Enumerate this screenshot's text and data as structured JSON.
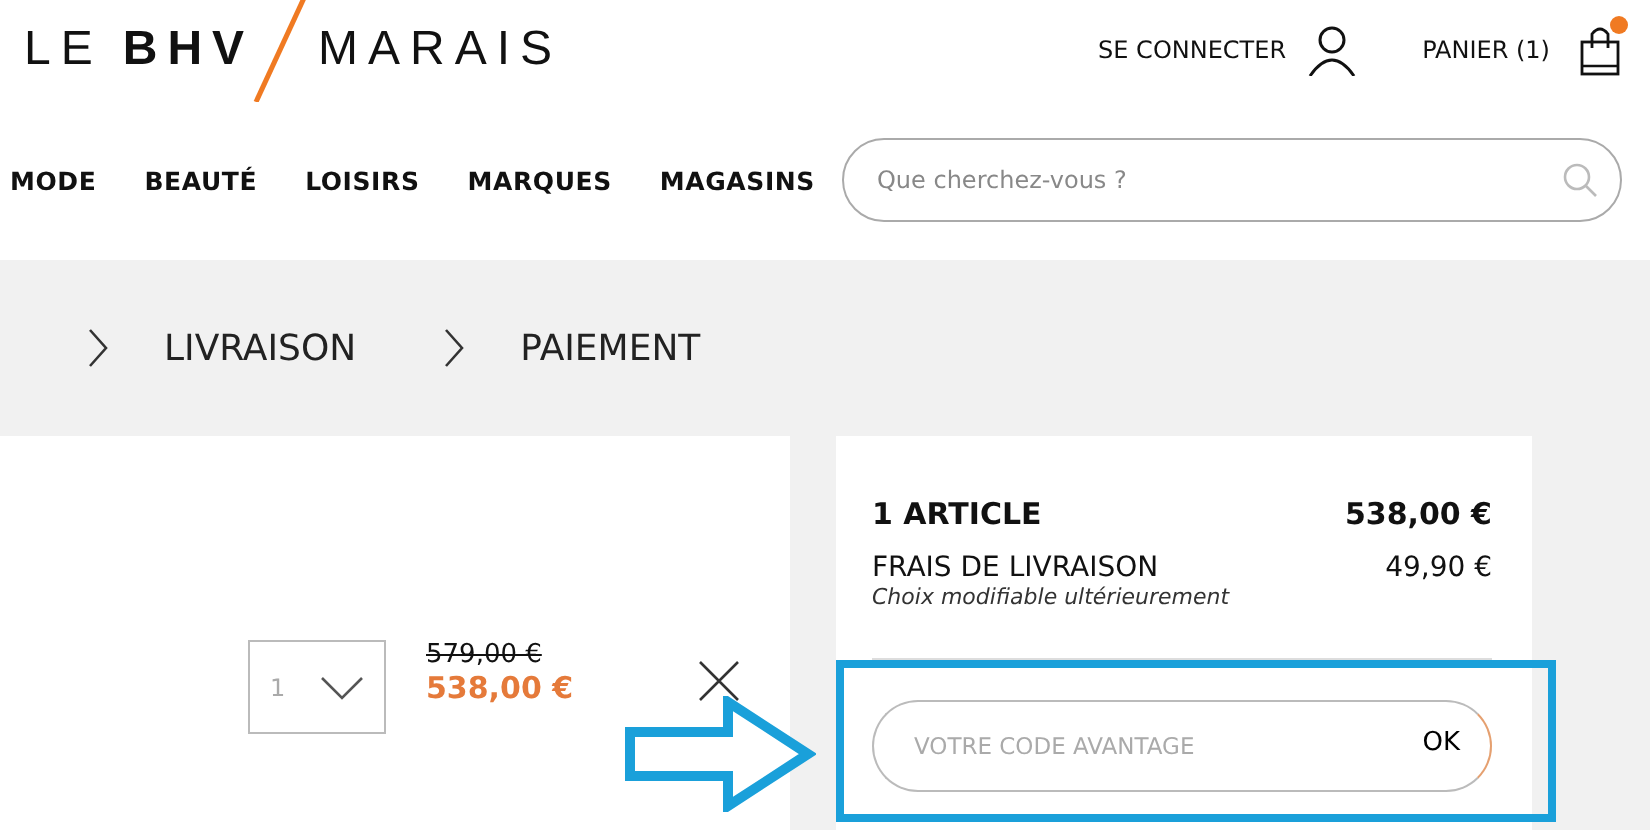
{
  "logo": {
    "prefix": "LE",
    "bold": "BHV",
    "suffix": "MARAIS"
  },
  "account": {
    "label": "SE CONNECTER"
  },
  "cart": {
    "label": "PANIER (1)",
    "has_items": true
  },
  "nav": {
    "items": [
      "MODE",
      "BEAUTÉ",
      "LOISIRS",
      "MARQUES",
      "MAGASINS"
    ]
  },
  "search": {
    "placeholder": "Que cherchez-vous ?"
  },
  "breadcrumb": [
    "LIVRAISON",
    "PAIEMENT"
  ],
  "item": {
    "quantity": "1",
    "old_price": "579,00 €",
    "price": "538,00 €"
  },
  "summary": {
    "articles_label": "1 ARTICLE",
    "articles_total": "538,00 €",
    "shipping_label": "FRAIS DE LIVRAISON",
    "shipping_price": "49,90 €",
    "shipping_note": "Choix modifiable ultérieurement"
  },
  "promo": {
    "placeholder": "VOTRE CODE AVANTAGE",
    "button": "OK"
  },
  "annotation": {
    "highlight": true,
    "arrow": true
  }
}
